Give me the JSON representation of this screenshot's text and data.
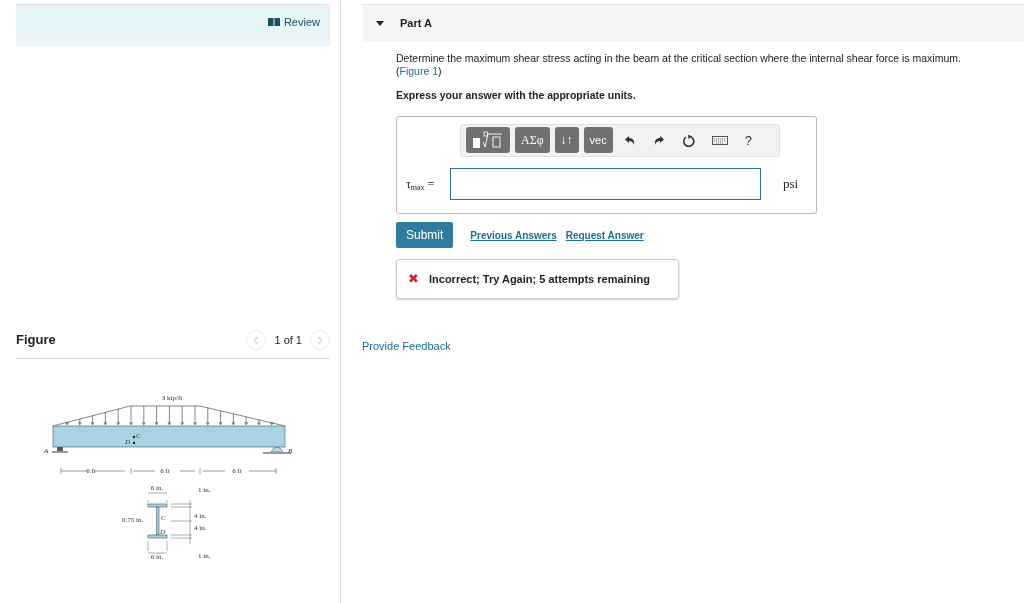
{
  "review": {
    "label": "Review"
  },
  "figure_panel": {
    "title": "Figure",
    "pager": "1 of 1",
    "prev_disabled": true,
    "next_disabled": true
  },
  "figure": {
    "load": "3 kip/ft",
    "points": [
      "A",
      "B",
      "D",
      "C"
    ],
    "spans": [
      "6 ft",
      "6 ft",
      "6 ft"
    ],
    "section_labels": [
      "6 in.",
      "1 in.",
      "4 in.",
      "0.75 in.",
      "4 in.",
      "1 in.",
      "6 in."
    ],
    "section_points": [
      "C",
      "D"
    ]
  },
  "part": {
    "title": "Part A",
    "expanded": true,
    "question": "Determine the maximum shear stress acting in the beam at the critical section where the internal shear force is maximum.",
    "figure_ref": {
      "open": "(",
      "link": "Figure 1",
      "close": ")"
    },
    "instruction": "Express your answer with the appropriate units.",
    "toolbar": [
      {
        "kind": "templates"
      },
      {
        "kind": "greek",
        "label": "ΑΣφ"
      },
      {
        "kind": "arrows",
        "label": "↓↑"
      },
      {
        "kind": "vec",
        "label": "vec"
      },
      {
        "kind": "undo"
      },
      {
        "kind": "redo"
      },
      {
        "kind": "reset"
      },
      {
        "kind": "keyboard"
      },
      {
        "kind": "help",
        "label": "?"
      }
    ],
    "answer": {
      "symbol": "τ",
      "subscript": "max",
      "equals": "=",
      "unit": "psi"
    },
    "submit": "Submit",
    "links": [
      "Previous Answers",
      "Request Answer"
    ],
    "feedback": {
      "correct": false,
      "icon": "✖",
      "message": "Incorrect; Try Again; 5 attempts remaining"
    }
  },
  "provide_feedback": "Provide Feedback"
}
